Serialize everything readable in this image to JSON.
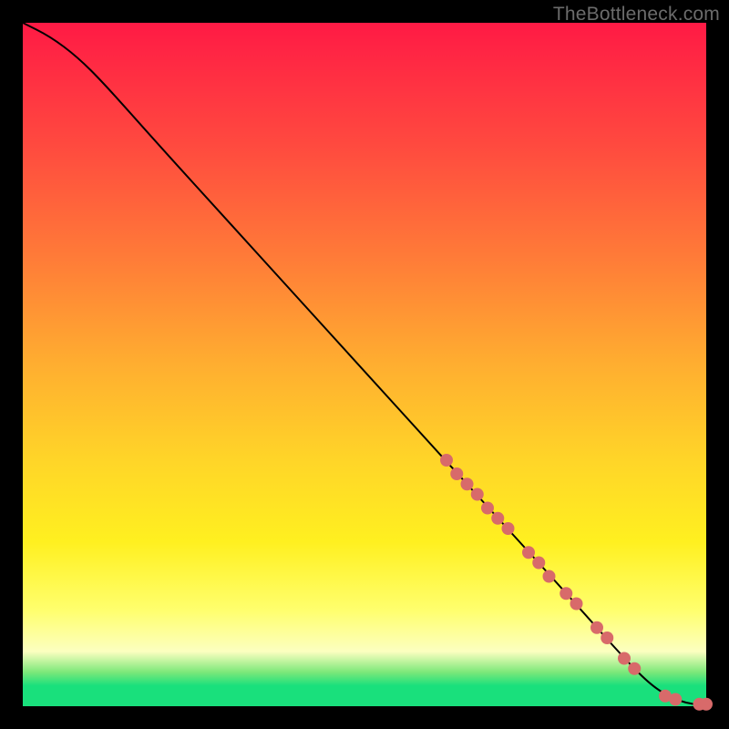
{
  "watermark": "TheBottleneck.com",
  "chart_data": {
    "type": "line",
    "title": "",
    "xlabel": "",
    "ylabel": "",
    "xlim": [
      0,
      100
    ],
    "ylim": [
      0,
      100
    ],
    "grid": false,
    "series": [
      {
        "name": "curve",
        "x": [
          0,
          4,
          8,
          12,
          20,
          30,
          40,
          50,
          60,
          70,
          80,
          88,
          92,
          95,
          97,
          99,
          100
        ],
        "y": [
          100,
          98,
          95,
          91,
          82,
          71,
          60,
          49,
          38,
          27,
          16,
          7,
          3,
          1.2,
          0.5,
          0.2,
          0.2
        ],
        "stroke": "#000000",
        "stroke_width": 2
      }
    ],
    "markers": {
      "name": "highlight-dots",
      "color": "#d86a6a",
      "radius": 7,
      "points": [
        {
          "x": 62,
          "y": 36
        },
        {
          "x": 63.5,
          "y": 34
        },
        {
          "x": 65,
          "y": 32.5
        },
        {
          "x": 66.5,
          "y": 31
        },
        {
          "x": 68,
          "y": 29
        },
        {
          "x": 69.5,
          "y": 27.5
        },
        {
          "x": 71,
          "y": 26
        },
        {
          "x": 74,
          "y": 22.5
        },
        {
          "x": 75.5,
          "y": 21
        },
        {
          "x": 77,
          "y": 19
        },
        {
          "x": 79.5,
          "y": 16.5
        },
        {
          "x": 81,
          "y": 15
        },
        {
          "x": 84,
          "y": 11.5
        },
        {
          "x": 85.5,
          "y": 10
        },
        {
          "x": 88,
          "y": 7
        },
        {
          "x": 89.5,
          "y": 5.5
        },
        {
          "x": 94,
          "y": 1.5
        },
        {
          "x": 95.5,
          "y": 1
        },
        {
          "x": 99,
          "y": 0.3
        },
        {
          "x": 100,
          "y": 0.3
        }
      ]
    }
  }
}
